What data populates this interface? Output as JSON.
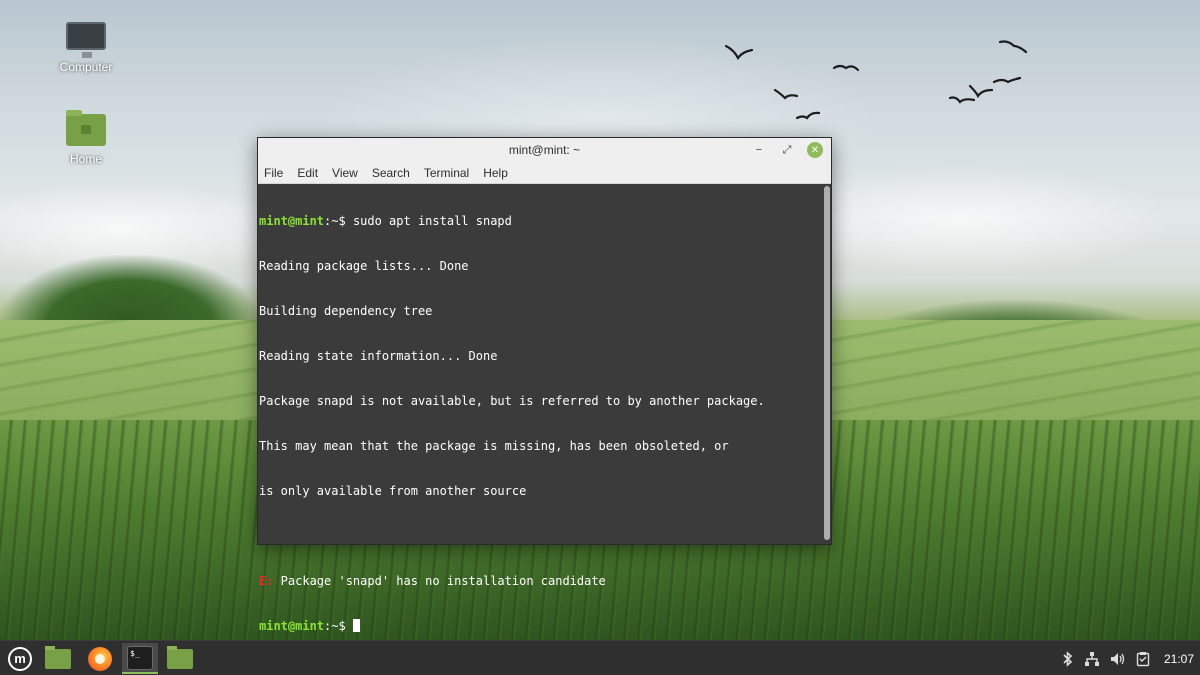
{
  "desktop": {
    "icons": [
      {
        "label": "Computer"
      },
      {
        "label": "Home"
      }
    ]
  },
  "window": {
    "title": "mint@mint: ~",
    "controls": {
      "minimize": "−",
      "maximize": "⤢",
      "close": "✕"
    },
    "menu": [
      "File",
      "Edit",
      "View",
      "Search",
      "Terminal",
      "Help"
    ]
  },
  "terminal": {
    "prompt_user_host": "mint@mint",
    "prompt_suffix": ":~$ ",
    "command": "sudo apt install snapd",
    "output": [
      "Reading package lists... Done",
      "Building dependency tree",
      "Reading state information... Done",
      "Package snapd is not available, but is referred to by another package.",
      "This may mean that the package is missing, has been obsoleted, or",
      "is only available from another source"
    ],
    "error_prefix": "E:",
    "error_message": " Package 'snapd' has no installation candidate"
  },
  "taskbar": {
    "menu_logo": "m",
    "terminal_icon_text": "$_",
    "tray_icons": [
      "bluetooth-icon",
      "network-icon",
      "volume-icon",
      "clipboard-icon"
    ],
    "clock": "21:07"
  }
}
